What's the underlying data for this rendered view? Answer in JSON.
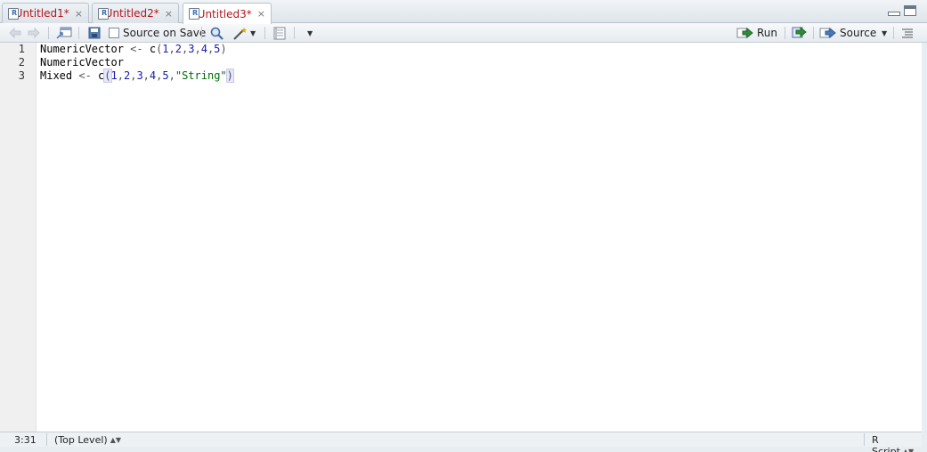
{
  "tabs": [
    {
      "label": "Untitled1*",
      "icon": "r-script-icon"
    },
    {
      "label": "Untitled2*",
      "icon": "r-script-icon"
    },
    {
      "label": "Untitled3*",
      "icon": "r-script-icon"
    }
  ],
  "tab_close_glyph": "×",
  "toolbar": {
    "source_on_save_label": "Source on Save",
    "run_label": "Run",
    "source_label": "Source"
  },
  "editor": {
    "line_numbers": [
      "1",
      "2",
      "3"
    ],
    "lines": [
      {
        "tokens": [
          {
            "t": "NumericVector",
            "c": "id"
          },
          {
            "t": " <- ",
            "c": "op"
          },
          {
            "t": "c",
            "c": "id"
          },
          {
            "t": "(",
            "c": "paren"
          },
          {
            "t": "1",
            "c": "num"
          },
          {
            "t": ",",
            "c": "op"
          },
          {
            "t": "2",
            "c": "num"
          },
          {
            "t": ",",
            "c": "op"
          },
          {
            "t": "3",
            "c": "num"
          },
          {
            "t": ",",
            "c": "op"
          },
          {
            "t": "4",
            "c": "num"
          },
          {
            "t": ",",
            "c": "op"
          },
          {
            "t": "5",
            "c": "num"
          },
          {
            "t": ")",
            "c": "paren"
          }
        ]
      },
      {
        "tokens": [
          {
            "t": "NumericVector",
            "c": "id"
          }
        ]
      },
      {
        "tokens": [
          {
            "t": "Mixed",
            "c": "id"
          },
          {
            "t": " <- ",
            "c": "op"
          },
          {
            "t": "c",
            "c": "id"
          },
          {
            "t": "(",
            "c": "paren-match"
          },
          {
            "t": "1",
            "c": "num"
          },
          {
            "t": ",",
            "c": "op"
          },
          {
            "t": "2",
            "c": "num"
          },
          {
            "t": ",",
            "c": "op"
          },
          {
            "t": "3",
            "c": "num"
          },
          {
            "t": ",",
            "c": "op"
          },
          {
            "t": "4",
            "c": "num"
          },
          {
            "t": ",",
            "c": "op"
          },
          {
            "t": "5",
            "c": "num"
          },
          {
            "t": ",",
            "c": "op"
          },
          {
            "t": "\"String\"",
            "c": "str"
          },
          {
            "t": ")",
            "c": "paren-match"
          }
        ]
      }
    ]
  },
  "status": {
    "position": "3:31",
    "scope": "(Top Level)",
    "file_type": "R Script"
  },
  "colors": {
    "tab_label": "#b5161b",
    "number": "#1a1aa6",
    "string": "#036a07",
    "run_arrow": "#2f8a3a"
  }
}
